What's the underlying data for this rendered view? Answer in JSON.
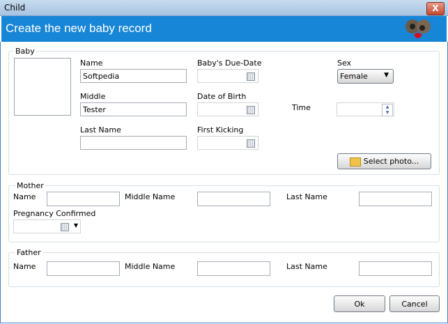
{
  "window": {
    "title": "Child",
    "close_label": "X"
  },
  "banner": {
    "heading": "Create the new baby record"
  },
  "baby": {
    "group_label": "Baby",
    "name_label": "Name",
    "name_value": "Softpedia",
    "middle_label": "Middle",
    "middle_value": "Tester",
    "last_name_label": "Last Name",
    "last_name_value": "",
    "due_date_label": "Baby's Due-Date",
    "dob_label": "Date of Birth",
    "first_kicking_label": "First Kicking",
    "sex_label": "Sex",
    "sex_value": "Female",
    "time_label": "Time",
    "select_photo_label": "Select photo..."
  },
  "mother": {
    "group_label": "Mother",
    "name_label": "Name",
    "middle_name_label": "Middle Name",
    "last_name_label": "Last Name",
    "pregnancy_label": "Pregnancy Confirmed"
  },
  "father": {
    "group_label": "Father",
    "name_label": "Name",
    "middle_name_label": "Middle Name",
    "last_name_label": "Last Name"
  },
  "buttons": {
    "ok": "Ok",
    "cancel": "Cancel"
  }
}
